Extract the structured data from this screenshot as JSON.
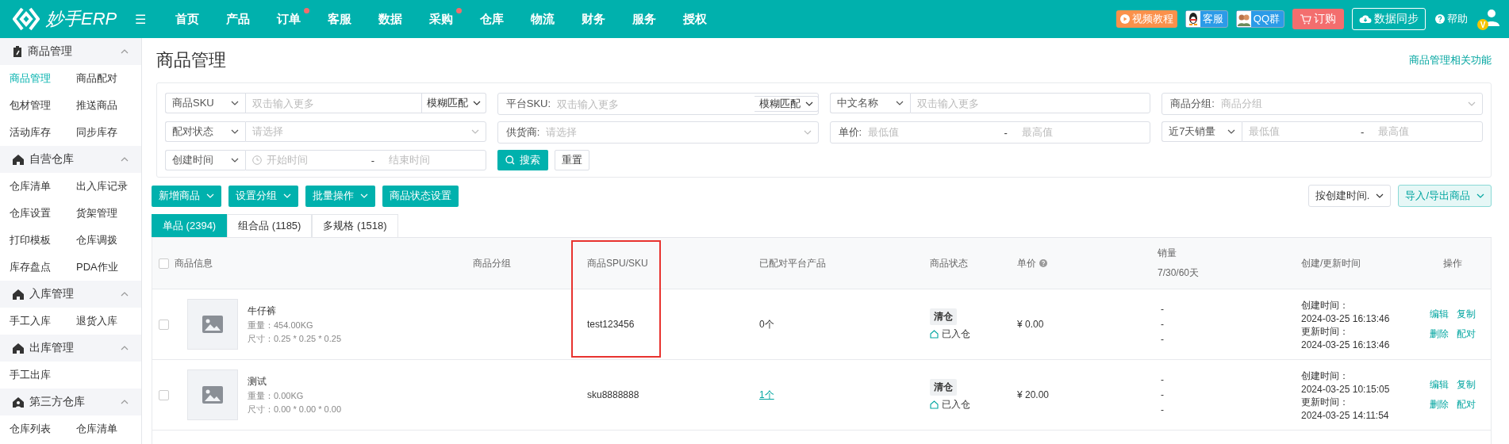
{
  "topbar": {
    "logo": "妙手ERP",
    "menu_icon": "☰",
    "nav": [
      {
        "label": "首页",
        "badge": false
      },
      {
        "label": "产品",
        "badge": false
      },
      {
        "label": "订单",
        "badge": true
      },
      {
        "label": "客服",
        "badge": false
      },
      {
        "label": "数据",
        "badge": false
      },
      {
        "label": "采购",
        "badge": true
      },
      {
        "label": "仓库",
        "badge": false
      },
      {
        "label": "物流",
        "badge": false
      },
      {
        "label": "财务",
        "badge": false
      },
      {
        "label": "服务",
        "badge": false
      },
      {
        "label": "授权",
        "badge": false
      }
    ],
    "actions": [
      {
        "kind": "video",
        "label": "视频教程"
      },
      {
        "kind": "qq",
        "label": "客服"
      },
      {
        "kind": "qq-group",
        "label": "QQ群"
      },
      {
        "kind": "order",
        "label": "订购"
      },
      {
        "kind": "sync",
        "label": "数据同步"
      },
      {
        "kind": "help",
        "label": "帮助"
      }
    ],
    "vip_badge": "V"
  },
  "sidebar": {
    "groups": [
      {
        "kind": "goods",
        "title": "商品管理",
        "expanded": true,
        "items": [
          {
            "label": "商品管理",
            "selected": true
          },
          {
            "label": "商品配对",
            "selected": false
          },
          {
            "label": "包材管理",
            "selected": false
          },
          {
            "label": "推送商品",
            "selected": false
          },
          {
            "label": "活动库存",
            "selected": false
          },
          {
            "label": "同步库存",
            "selected": false
          }
        ]
      },
      {
        "kind": "warehouse",
        "title": "自营仓库",
        "expanded": true,
        "items": [
          {
            "label": "仓库清单",
            "selected": false
          },
          {
            "label": "出入库记录",
            "selected": false
          },
          {
            "label": "仓库设置",
            "selected": false
          },
          {
            "label": "货架管理",
            "selected": false
          },
          {
            "label": "打印模板",
            "selected": false
          },
          {
            "label": "仓库调拨",
            "selected": false
          },
          {
            "label": "库存盘点",
            "selected": false
          },
          {
            "label": "PDA作业",
            "selected": false
          }
        ]
      },
      {
        "kind": "warehouse",
        "title": "入库管理",
        "expanded": true,
        "items": [
          {
            "label": "手工入库",
            "selected": false
          },
          {
            "label": "退货入库",
            "selected": false
          }
        ]
      },
      {
        "kind": "warehouse",
        "title": "出库管理",
        "expanded": true,
        "items": [
          {
            "label": "手工出库",
            "selected": false
          }
        ]
      },
      {
        "kind": "third-party",
        "title": "第三方仓库",
        "expanded": true,
        "items": [
          {
            "label": "仓库列表",
            "selected": false
          },
          {
            "label": "仓库清单",
            "selected": false
          }
        ]
      }
    ]
  },
  "page": {
    "title": "商品管理",
    "help_link": "商品管理相关功能"
  },
  "filters": {
    "rows": [
      [
        {
          "select": "商品SKU",
          "kind": "input",
          "placeholder": "双击输入更多",
          "match": "模糊匹配"
        },
        {
          "label": "平台SKU:",
          "kind": "input",
          "placeholder": "双击输入更多",
          "match": "模糊匹配"
        },
        {
          "select": "中文名称",
          "kind": "input",
          "placeholder": "双击输入更多"
        },
        {
          "label": "商品分组:",
          "kind": "dropdown",
          "placeholder": "商品分组"
        }
      ],
      [
        {
          "select": "配对状态",
          "kind": "dropdown",
          "placeholder": "请选择"
        },
        {
          "label": "供货商:",
          "kind": "dropdown",
          "placeholder": "请选择"
        },
        {
          "label": "单价:",
          "kind": "range",
          "min": "最低值",
          "separator": "-",
          "max": "最高值"
        },
        {
          "select": "近7天销量",
          "kind": "range",
          "min": "最低值",
          "separator": "-",
          "max": "最高值"
        }
      ],
      [
        {
          "select": "创建时间",
          "kind": "date-range",
          "min": "开始时间",
          "separator": "-",
          "max": "结束时间"
        }
      ]
    ],
    "search_button": "搜索",
    "reset_button": "重置"
  },
  "toolbar": {
    "buttons": [
      {
        "label": "新增商品",
        "dropdown": true
      },
      {
        "label": "设置分组",
        "dropdown": true
      },
      {
        "label": "批量操作",
        "dropdown": true
      },
      {
        "label": "商品状态设置",
        "dropdown": false
      }
    ],
    "sort": "按创建时间.",
    "export": "导入/导出商品"
  },
  "tabs": [
    {
      "label": "单品 (2394)",
      "selected": true
    },
    {
      "label": "组合品 (1185)",
      "selected": false
    },
    {
      "label": "多规格 (1518)",
      "selected": false
    }
  ],
  "table": {
    "select_all_checked": false,
    "columns": [
      {
        "label": "商品信息",
        "highlighted": false
      },
      {
        "label": "商品分组",
        "highlighted": false
      },
      {
        "label": "商品SPU/SKU",
        "highlighted": true
      },
      {
        "label": "已配对平台产品",
        "highlighted": false
      },
      {
        "label": "商品状态",
        "highlighted": false
      },
      {
        "label": "单价",
        "highlighted": false,
        "help": true
      },
      {
        "label": "销量",
        "sub": "7/30/60天",
        "highlighted": false
      },
      {
        "label": "创建/更新时间",
        "highlighted": false
      },
      {
        "label": "操作",
        "highlighted": false
      }
    ],
    "rows": [
      {
        "checked": false,
        "name": "牛仔裤",
        "weight": "重量：454.00KG",
        "size": "尺寸：0.25 * 0.25 * 0.25",
        "sku": "test123456",
        "matched": "0个",
        "matched_link": false,
        "tag": "清仓",
        "stock_status": "已入仓",
        "price": "¥ 0.00",
        "sales": [
          "-",
          "-",
          "-"
        ],
        "created_label": "创建时间：",
        "created": "2024-03-25 16:13:46",
        "updated_label": "更新时间：",
        "updated": "2024-03-25 16:13:46",
        "actions": [
          "编辑",
          "复制",
          "删除",
          "配对"
        ]
      },
      {
        "checked": false,
        "name": "测试",
        "weight": "重量：0.00KG",
        "size": "尺寸：0.00 * 0.00 * 0.00",
        "sku": "sku8888888",
        "matched": "1个",
        "matched_link": true,
        "tag": "清仓",
        "stock_status": "已入仓",
        "price": "¥ 20.00",
        "sales": [
          "-",
          "-",
          "-"
        ],
        "created_label": "创建时间：",
        "created": "2024-03-25 10:15:05",
        "updated_label": "更新时间：",
        "updated": "2024-03-25 14:11:54",
        "actions": [
          "编辑",
          "复制",
          "删除",
          "配对"
        ]
      }
    ]
  }
}
